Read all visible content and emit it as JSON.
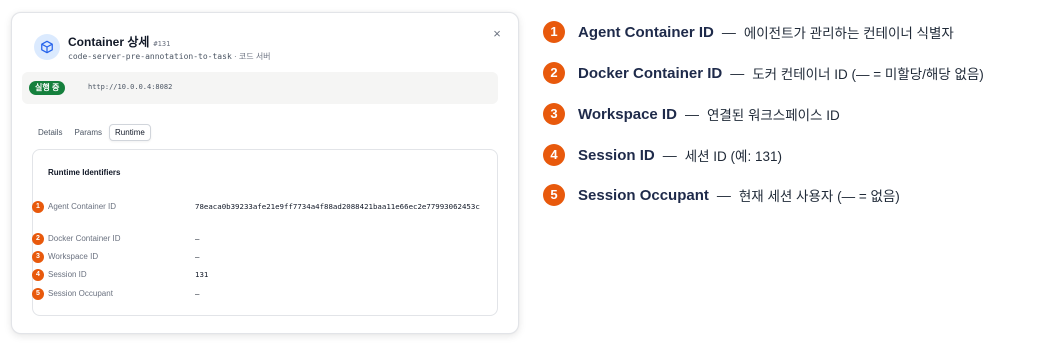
{
  "modal": {
    "title": "Container 상세",
    "number": "#131",
    "subtitle": "code-server-pre-annotation-to-task",
    "subtitle_sep": " · ",
    "subtitle_kind": "코드 서버",
    "close_glyph": "×",
    "status_label": "실행 중",
    "status_color": "#15803d",
    "url": "http://10.0.0.4:8082",
    "tabs": [
      {
        "label": "Details",
        "active": false
      },
      {
        "label": "Params",
        "active": false
      },
      {
        "label": "Runtime",
        "active": true
      }
    ],
    "panel_title": "Runtime Identifiers",
    "rows": [
      {
        "num": "1",
        "label": "Agent Container ID",
        "value": "78eaca0b39233afe21e9ff7734a4f88ad2088421baa11e66ec2e77993062453c"
      },
      {
        "num": "2",
        "label": "Docker Container ID",
        "value": "—"
      },
      {
        "num": "3",
        "label": "Workspace ID",
        "value": "—"
      },
      {
        "num": "4",
        "label": "Session ID",
        "value": "131"
      },
      {
        "num": "5",
        "label": "Session Occupant",
        "value": "—"
      }
    ]
  },
  "legend": {
    "dash": "—",
    "accent_color": "#e8590c",
    "items": [
      {
        "num": "1",
        "name": "Agent Container ID",
        "desc": "에이전트가 관리하는 컨테이너 식별자"
      },
      {
        "num": "2",
        "name": "Docker Container ID",
        "desc": "도커 컨테이너 ID (— = 미할당/해당 없음)"
      },
      {
        "num": "3",
        "name": "Workspace ID",
        "desc": "연결된 워크스페이스 ID"
      },
      {
        "num": "4",
        "name": "Session ID",
        "desc": "세션 ID (예: 131)"
      },
      {
        "num": "5",
        "name": "Session Occupant",
        "desc": "현재 세션 사용자 (— = 없음)"
      }
    ]
  },
  "icons": {
    "container": "box-icon",
    "close": "close-icon"
  }
}
